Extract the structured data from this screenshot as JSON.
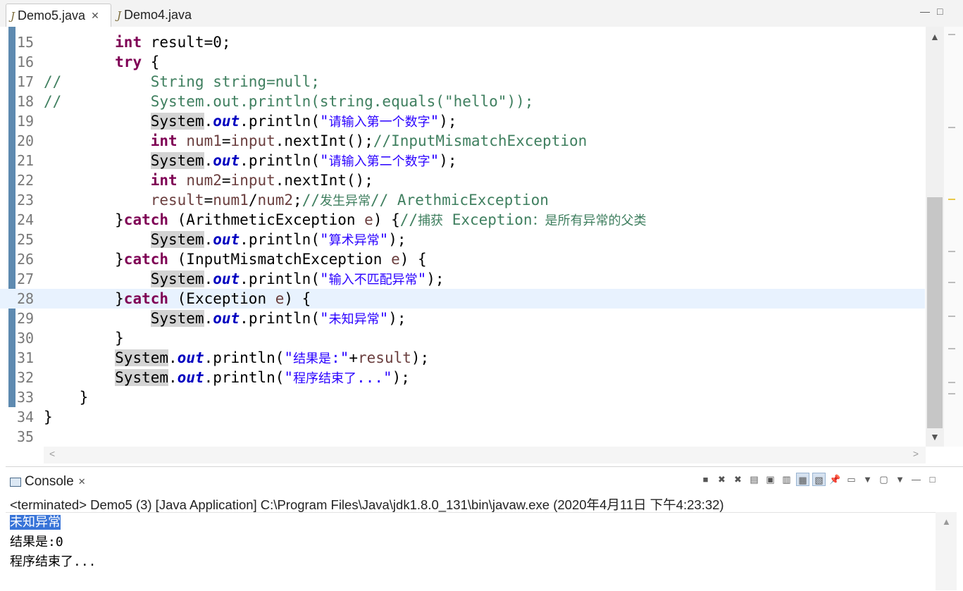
{
  "editor_tabs": [
    {
      "label": "Demo5.java",
      "close": "✕"
    },
    {
      "label": "Demo4.java"
    }
  ],
  "window_buttons": {
    "minimize": "—",
    "maximize": "□"
  },
  "code_lines": [
    {
      "n": "15",
      "html": "        <span class='kw'>int</span> result=0;"
    },
    {
      "n": "16",
      "html": "        <span class='kw'>try</span> {"
    },
    {
      "n": "17",
      "html": "<span class='cm'>//          String string=null;</span>"
    },
    {
      "n": "18",
      "html": "<span class='cm'>//          System.out.println(string.equals(\"hello\"));</span>"
    },
    {
      "n": "19",
      "html": "            <span class='occ'>System</span>.<span class='fld'>out</span>.println(<span class='st'>\"<span class='cjk'>请输入第一个数字</span>\"</span>);"
    },
    {
      "n": "20",
      "html": "            <span class='kw'>int</span> <span class='var'>num1</span>=<span class='var'>input</span>.nextInt();<span class='cm'>//InputMismatchException</span>"
    },
    {
      "n": "21",
      "html": "            <span class='occ'>System</span>.<span class='fld'>out</span>.println(<span class='st'>\"<span class='cjk'>请输入第二个数字</span>\"</span>);"
    },
    {
      "n": "22",
      "html": "            <span class='kw'>int</span> <span class='var'>num2</span>=<span class='var'>input</span>.nextInt();"
    },
    {
      "n": "23",
      "html": "            <span class='var'>result</span>=<span class='var'>num1</span>/<span class='var'>num2</span>;<span class='cm'>//<span class='cjk'>发生异常</span>// ArethmicException</span>"
    },
    {
      "n": "24",
      "html": "        }<span class='kw'>catch</span> (ArithmeticException <span class='var'>e</span>) {<span class='cm'>//<span class='cjk'>捕获</span> Exception<span class='cjk'>：是所有异常的父类</span></span>"
    },
    {
      "n": "25",
      "html": "            <span class='occ'>System</span>.<span class='fld'>out</span>.println(<span class='st'>\"<span class='cjk'>算术异常</span>\"</span>);"
    },
    {
      "n": "26",
      "html": "        }<span class='kw'>catch</span> (InputMismatchException <span class='var'>e</span>) {"
    },
    {
      "n": "27",
      "html": "            <span class='occ'>System</span>.<span class='fld'>out</span>.println(<span class='st'>\"<span class='cjk'>输入不匹配异常</span>\"</span>);"
    },
    {
      "n": "28",
      "html": "        }<span class='kw'>catch</span> (Exception <span class='var'>e</span>) {",
      "current": true
    },
    {
      "n": "29",
      "html": "            <span class='occ'>System</span>.<span class='fld'>out</span>.println(<span class='st'>\"<span class='cjk'>未知异常</span>\"</span>);"
    },
    {
      "n": "30",
      "html": "        }"
    },
    {
      "n": "31",
      "html": "        <span class='occ'>System</span>.<span class='fld'>out</span>.println(<span class='st'>\"<span class='cjk'>结果是</span>:\"</span>+<span class='var'>result</span>);"
    },
    {
      "n": "32",
      "html": "        <span class='occ'>System</span>.<span class='fld'>out</span>.println(<span class='st'>\"<span class='cjk'>程序结束了</span>...\"</span>);"
    },
    {
      "n": "33",
      "html": "    }"
    },
    {
      "n": "34",
      "html": "}"
    },
    {
      "n": "35",
      "html": ""
    }
  ],
  "console": {
    "tab_label": "Console",
    "tab_close": "✕",
    "status": "<terminated> Demo5 (3) [Java Application] C:\\Program Files\\Java\\jdk1.8.0_131\\bin\\javaw.exe (2020年4月11日 下午4:23:32)",
    "output": [
      {
        "text": "未知异常",
        "selected": true
      },
      {
        "text": "结果是:0"
      },
      {
        "text": "程序结束了..."
      }
    ],
    "toolbar": [
      {
        "name": "terminate-icon",
        "glyph": "■"
      },
      {
        "name": "remove-launch-icon",
        "glyph": "✖"
      },
      {
        "name": "remove-all-terminated-icon",
        "glyph": "✖"
      },
      {
        "name": "clear-console-icon",
        "glyph": "▤"
      },
      {
        "name": "scroll-lock-icon",
        "glyph": "▣"
      },
      {
        "name": "word-wrap-icon",
        "glyph": "▥"
      },
      {
        "name": "show-on-stdout-icon",
        "glyph": "▦",
        "on": true
      },
      {
        "name": "show-on-stderr-icon",
        "glyph": "▧",
        "on": true
      },
      {
        "name": "pin-console-icon",
        "glyph": "📌"
      },
      {
        "name": "display-console-icon",
        "glyph": "▭"
      },
      {
        "name": "display-console-menu-icon",
        "glyph": "▼"
      },
      {
        "name": "open-console-icon",
        "glyph": "▢"
      },
      {
        "name": "open-console-menu-icon",
        "glyph": "▼"
      },
      {
        "name": "minimize-icon",
        "glyph": "—"
      },
      {
        "name": "maximize-icon",
        "glyph": "□"
      }
    ]
  },
  "scroll": {
    "up": "▲",
    "down": "▼",
    "left": "<",
    "right": ">"
  }
}
